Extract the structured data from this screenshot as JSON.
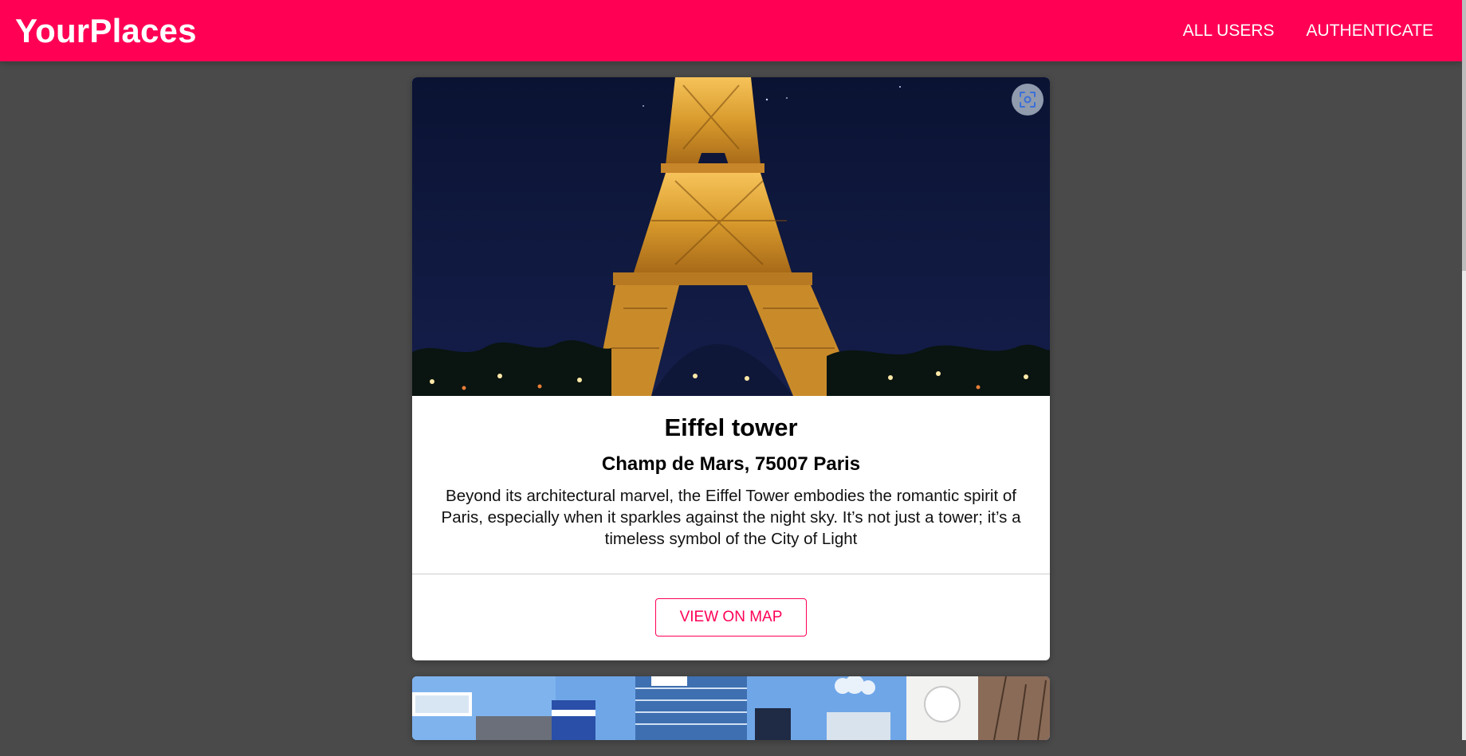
{
  "header": {
    "logo": "YourPlaces",
    "nav": {
      "all_users": "ALL USERS",
      "authenticate": "AUTHENTICATE"
    }
  },
  "places": [
    {
      "title": "Eiffel tower",
      "address": "Champ de Mars, 75007 Paris",
      "description": "Beyond its architectural marvel, the Eiffel Tower embodies the romantic spirit of Paris, especially when it sparkles against the night sky. It’s not just a tower; it’s a timeless symbol of the City of Light",
      "view_on_map_label": "VIEW ON MAP",
      "image_alt": "Eiffel tower at night"
    },
    {
      "image_alt": "Shibuya street scene"
    }
  ],
  "colors": {
    "brand": "#ff0055",
    "background": "#4a4a4a",
    "card": "#ffffff"
  }
}
